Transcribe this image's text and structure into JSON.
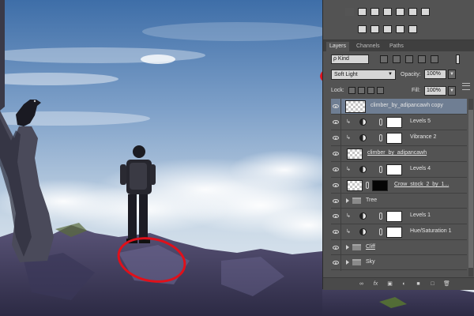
{
  "panel": {
    "tabs": [
      "Layers",
      "Channels",
      "Paths"
    ],
    "filter": {
      "kind_label": "ρ Kind"
    },
    "blend_mode": "Soft Light",
    "opacity_label": "Opacity:",
    "opacity_value": "100%",
    "lock_label": "Lock:",
    "fill_label": "Fill:",
    "fill_value": "100%",
    "layers": [
      {
        "name": "climber_by_adipancawh copy",
        "type": "pixel",
        "selected": true
      },
      {
        "name": "Levels 5",
        "type": "adjustment",
        "clipped": true
      },
      {
        "name": "Vibrance 2",
        "type": "adjustment",
        "clipped": true
      },
      {
        "name": "climber_by_adipancawh",
        "type": "smart"
      },
      {
        "name": "Levels 4",
        "type": "adjustment",
        "clipped": true
      },
      {
        "name": "Crow_stock_2_by_1...",
        "type": "smart-masked"
      },
      {
        "name": "Tree",
        "type": "group"
      },
      {
        "name": "Levels 1",
        "type": "adjustment",
        "clipped": true
      },
      {
        "name": "Hue/Saturation 1",
        "type": "adjustment",
        "clipped": true
      },
      {
        "name": "Cliff",
        "type": "group"
      },
      {
        "name": "Sky",
        "type": "group"
      }
    ]
  },
  "colors": {
    "annotation": "#e0101a",
    "selected_row": "#6f7e93",
    "panel_bg": "#535353"
  }
}
